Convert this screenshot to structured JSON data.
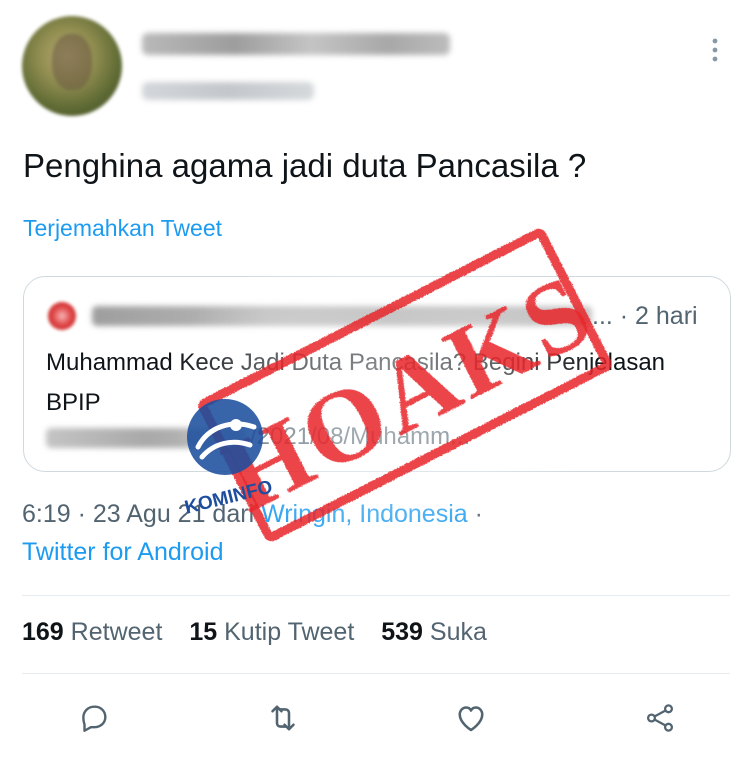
{
  "tweet": {
    "text": "Penghina agama jadi duta Pancasila ?",
    "translate_label": "Terjemahkan Tweet",
    "more_icon": "more-vertical-icon"
  },
  "quote": {
    "time": "... · 2 hari",
    "title": "Muhammad Kece Jadi Duta Pancasila? Begini Penjelasan BPIP",
    "url_tail": "/2021/08/Muhamm..."
  },
  "meta": {
    "time_date": "6:19 · 23 Agu 21 dari ",
    "location": "Wringin, Indonesia",
    "separator": " ·",
    "source": "Twitter for Android"
  },
  "stats": {
    "retweets_count": "169",
    "retweets_label": "Retweet",
    "quotes_count": "15",
    "quotes_label": "Kutip Tweet",
    "likes_count": "539",
    "likes_label": "Suka"
  },
  "actions": {
    "reply_icon": "reply-icon",
    "retweet_icon": "retweet-icon",
    "like_icon": "heart-icon",
    "share_icon": "share-icon"
  },
  "overlay": {
    "stamp_text": "HOAKS",
    "logo_text": "KOMINFO",
    "stamp_color": "#e8262b",
    "logo_color": "#1d4e9e"
  },
  "colors": {
    "link": "#1d9bf0",
    "muted": "#536471",
    "text": "#0f1419",
    "border": "#cfd9de"
  }
}
